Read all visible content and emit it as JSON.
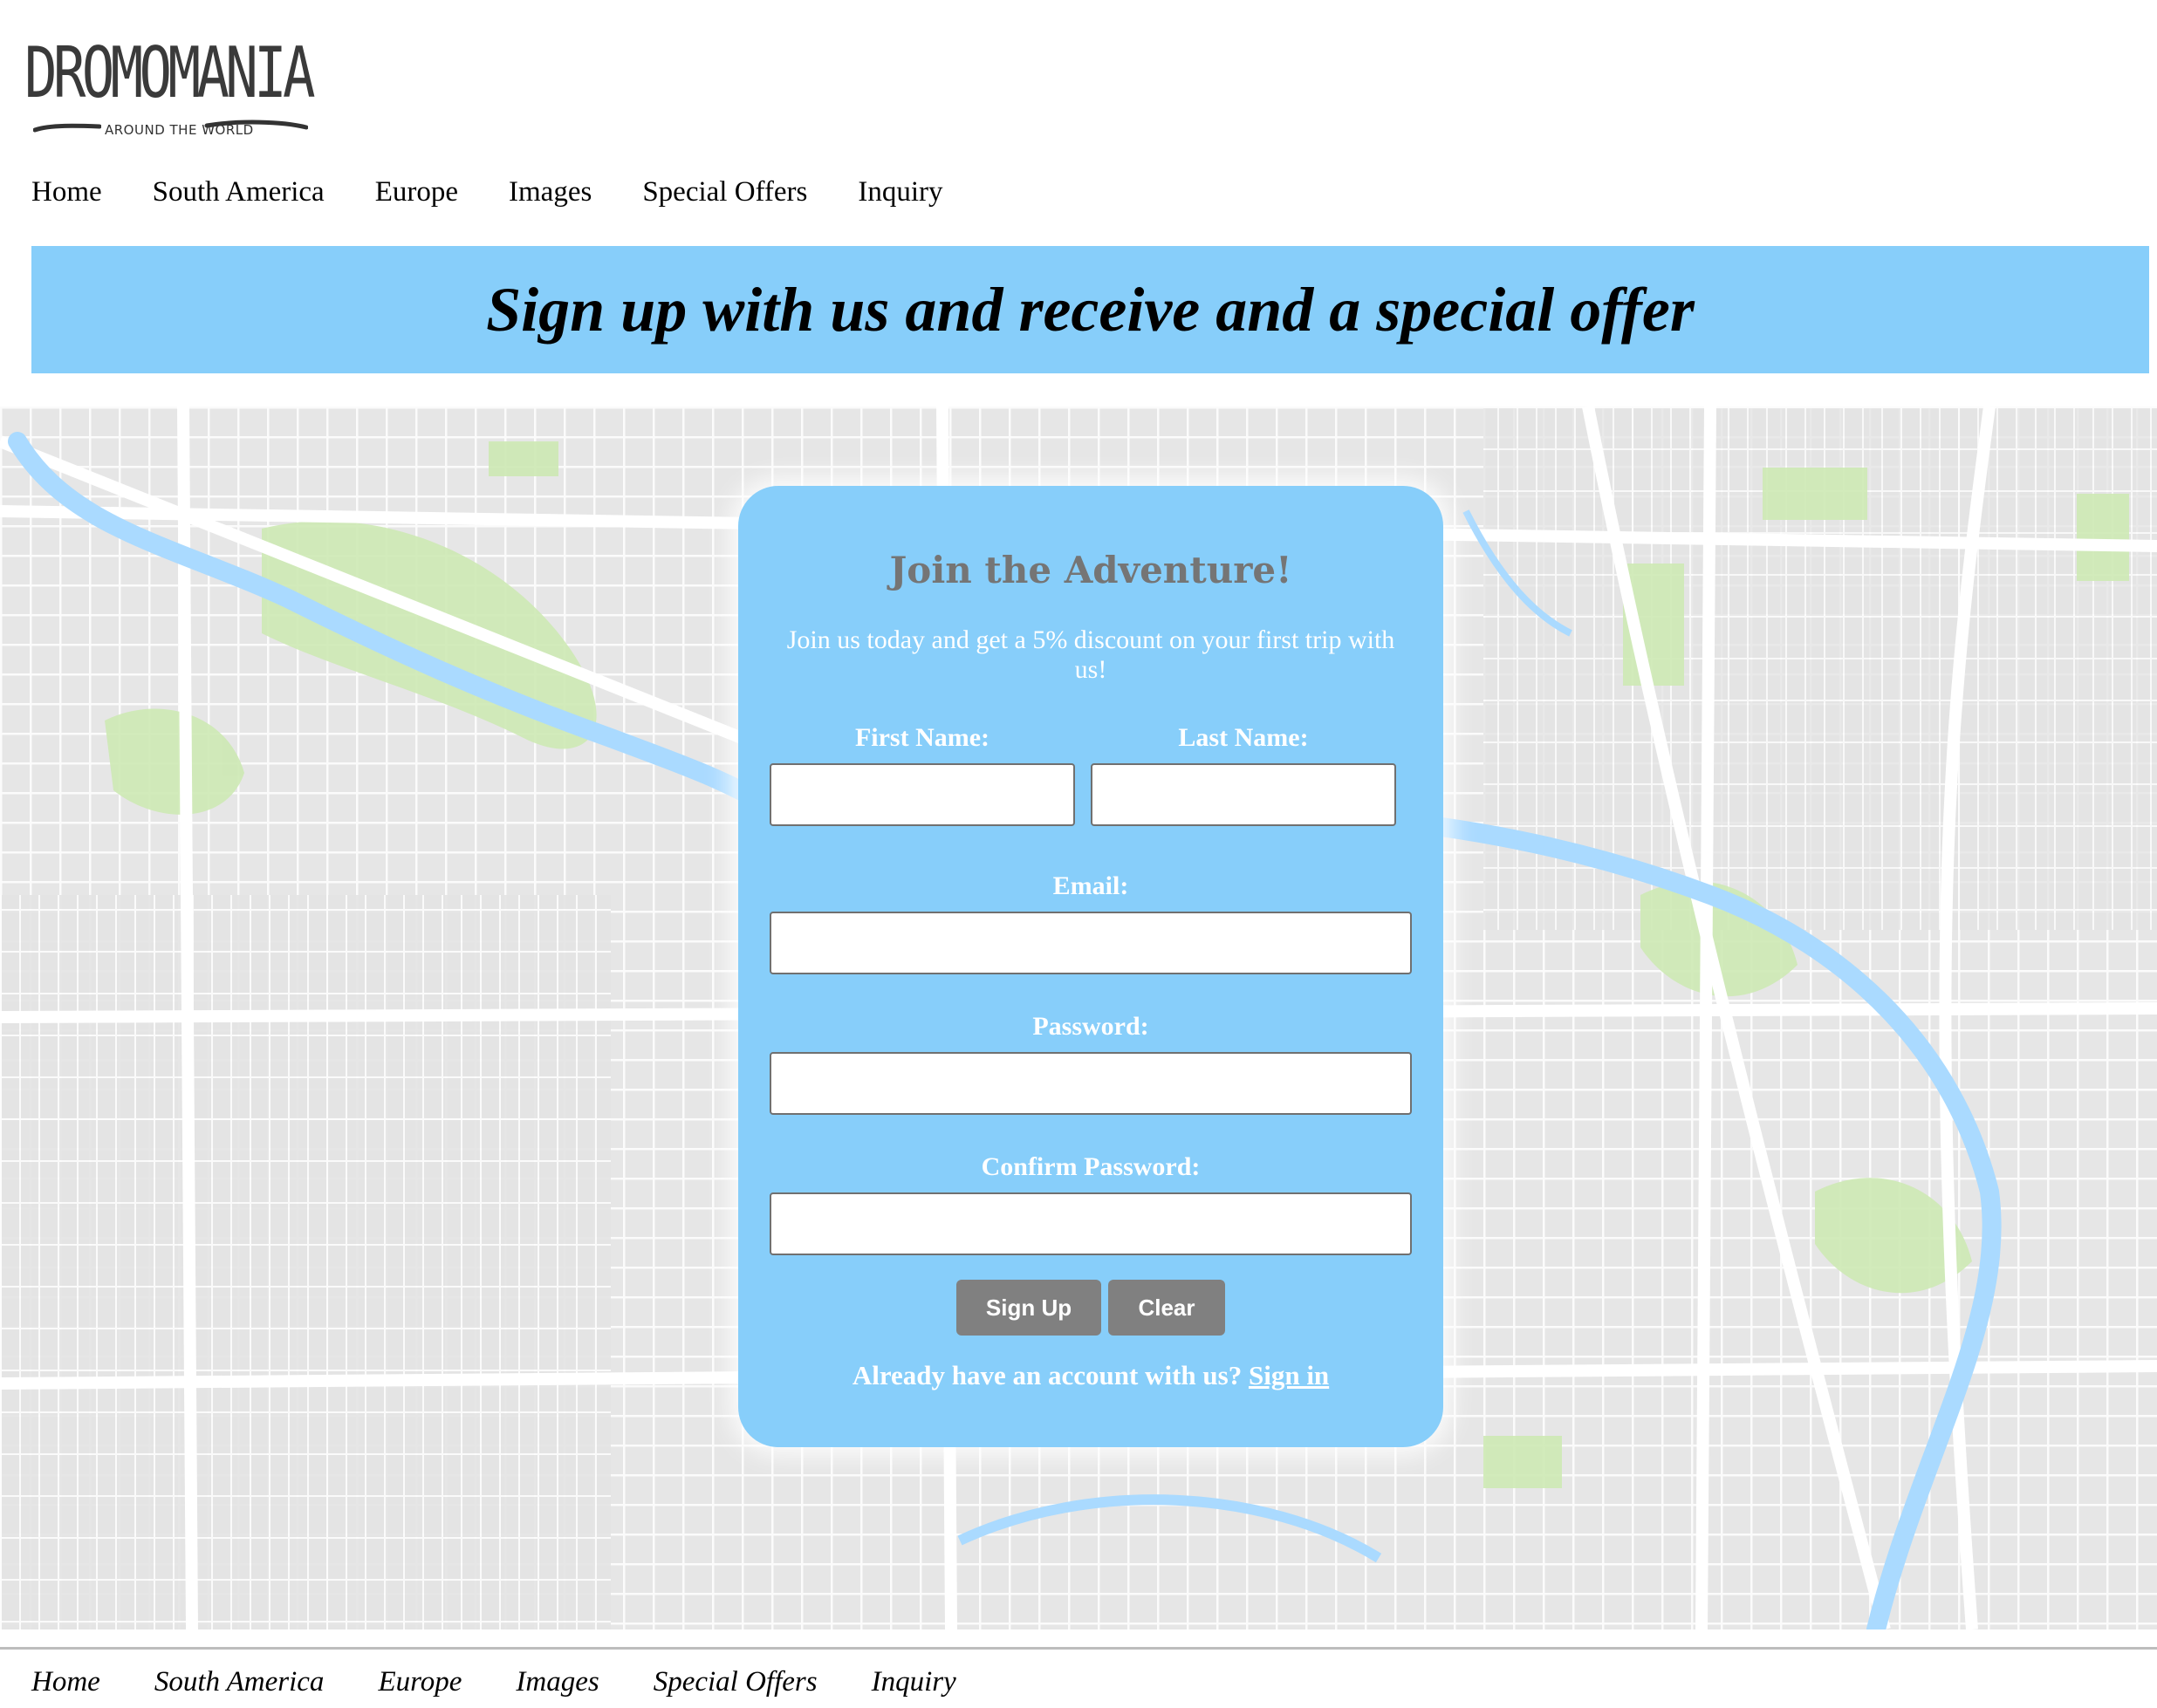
{
  "logo": {
    "wordmark": "DROMOMANIA",
    "tagline": "AROUND THE WORLD"
  },
  "nav": {
    "items": [
      "Home",
      "South America",
      "Europe",
      "Images",
      "Special Offers",
      "Inquiry"
    ]
  },
  "banner": {
    "headline": "Sign up with us and receive and a special offer",
    "background_color": "#87cefa"
  },
  "signup_form": {
    "title": "Join the Adventure!",
    "intro": "Join us today and get a 5% discount on your first trip with us!",
    "first_name_label": "First Name:",
    "first_name_value": "",
    "last_name_label": "Last Name:",
    "last_name_value": "",
    "email_label": "Email:",
    "email_value": "",
    "password_label": "Password:",
    "password_value": "",
    "confirm_password_label": "Confirm Password:",
    "confirm_password_value": "",
    "signup_button": "Sign Up",
    "clear_button": "Clear",
    "account_prompt": "Already have an account with us?",
    "signin_link": "Sign in",
    "card_color": "#87cefa",
    "button_color": "#808080"
  },
  "footer": {
    "nav_items": [
      "Home",
      "South America",
      "Europe",
      "Images",
      "Special Offers",
      "Inquiry"
    ]
  },
  "background": {
    "image": "street-map",
    "water_color": "#aadaff",
    "park_color": "#cde9b4"
  }
}
